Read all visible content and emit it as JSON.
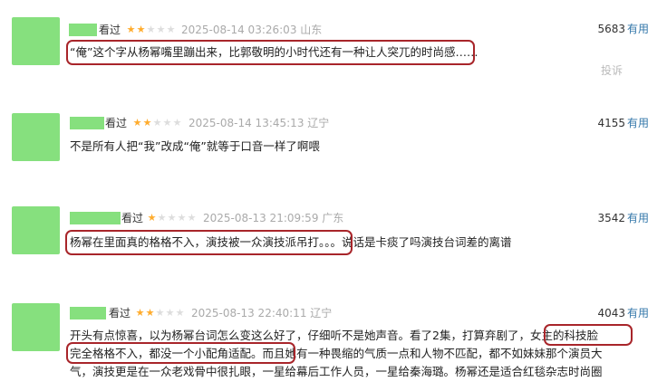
{
  "colors": {
    "placeholder": "#86e07e",
    "star_on": "#ffac2d",
    "star_off": "#dddddd",
    "link": "#3377aa",
    "highlight": "#a8252a"
  },
  "comments": [
    {
      "watched": "看过",
      "rating": 2,
      "time": "2025-08-14 03:26:03",
      "location": "山东",
      "votes": "5683",
      "useful": "有用",
      "text": "“俺”这个字从杨幂嘴里蹦出来，比郭敬明的小时代还有一种让人突兀的时尚感……",
      "report": "投诉"
    },
    {
      "watched": "看过",
      "rating": 2,
      "time": "2025-08-14 13:45:13",
      "location": "辽宁",
      "votes": "4155",
      "useful": "有用",
      "text": "不是所有人把“我”改成“俺”就等于口音一样了啊喂"
    },
    {
      "watched": "看过",
      "rating": 1,
      "time": "2025-08-13 21:09:59",
      "location": "广东",
      "votes": "3542",
      "useful": "有用",
      "text": "杨幂在里面真的格格不入，演技被一众演技派吊打。。。说话是卡痰了吗演技台词差的离谱"
    },
    {
      "watched": "看过",
      "rating": 2,
      "time": "2025-08-13 22:40:11",
      "location": "辽宁",
      "votes": "4043",
      "useful": "有用",
      "lines": [
        "开头有点惊喜，以为杨幂台词怎么变这么好了，仔细听不是她声音。看了2集，打算弃剧了，女主的科技脸",
        "完全格格不入，都没一个小配角适配。而且她有一种畏缩的气质一点和人物不匹配，都不如妹妹那个演员大",
        "气，演技更是在一众老戏骨中很扎眼，一星给幕后工作人员，一星给秦海璐。杨幂还是适合红毯杂志时尚圈"
      ]
    }
  ]
}
